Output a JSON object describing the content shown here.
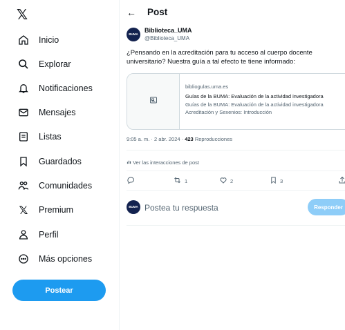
{
  "app": {
    "logo": "𝕏"
  },
  "sidebar": {
    "items": [
      {
        "label": "Inicio",
        "icon": "home-icon"
      },
      {
        "label": "Explorar",
        "icon": "search-icon"
      },
      {
        "label": "Notificaciones",
        "icon": "bell-icon"
      },
      {
        "label": "Mensajes",
        "icon": "mail-icon"
      },
      {
        "label": "Listas",
        "icon": "list-icon"
      },
      {
        "label": "Guardados",
        "icon": "bookmark-icon"
      },
      {
        "label": "Comunidades",
        "icon": "people-icon"
      },
      {
        "label": "Premium",
        "icon": "x-logo-icon"
      },
      {
        "label": "Perfil",
        "icon": "person-icon"
      },
      {
        "label": "Más opciones",
        "icon": "more-icon"
      }
    ],
    "post_button": "Postear"
  },
  "header": {
    "back": "←",
    "title": "Post"
  },
  "tweet": {
    "avatar_text": "BUMA",
    "author_name": "Biblioteca_UMA",
    "author_handle": "@Biblioteca_UMA",
    "text": "¿Pensando en la acreditación para tu acceso al cuerpo docente universitario? Nuestra guía a tal efecto te tiene informado:",
    "card": {
      "domain": "bibliogulas.uma.es",
      "title": "Guías de la BUMA: Evaluación de la actividad investigadora",
      "desc_line1": "Guías de la BUMA: Evaluación de la actividad investigadora",
      "desc_line2": "Acreditación y Sexenios: Introducción"
    },
    "meta_time": "9:05 a. m. · 2 abr. 2024 · ",
    "meta_views_count": "423",
    "meta_views_label": " Reproducciones",
    "interactions_link": "Ver las interacciones de post",
    "actions": {
      "reply_count": "",
      "retweet_count": "1",
      "like_count": "2",
      "bookmark_count": "3"
    }
  },
  "reply": {
    "placeholder": "Postea tu respuesta",
    "button": "Responder"
  },
  "colors": {
    "accent": "#1d9bf0",
    "accent_disabled": "#8ecdf8",
    "muted": "#536471"
  }
}
